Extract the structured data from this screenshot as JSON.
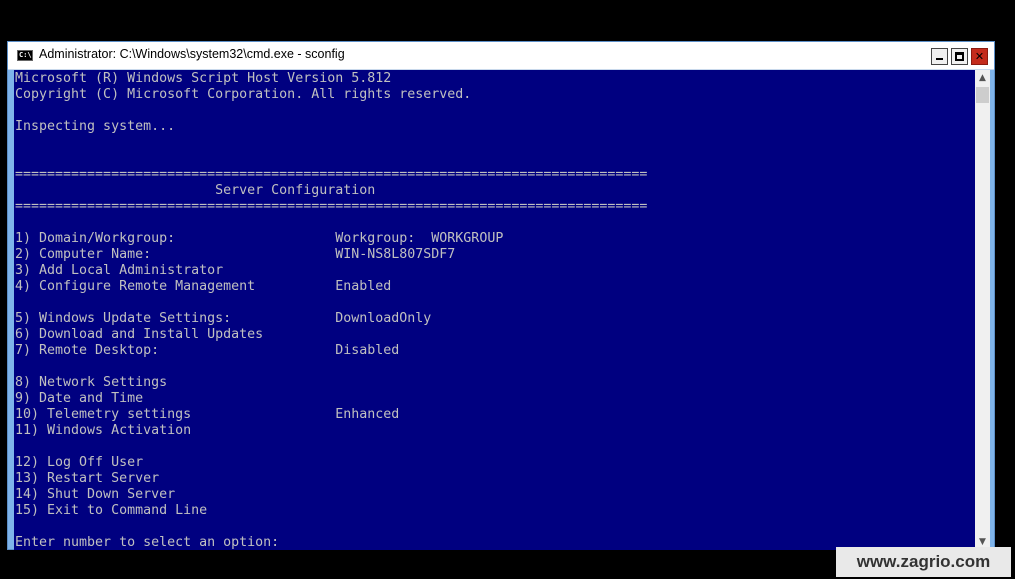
{
  "window": {
    "title": "Administrator: C:\\Windows\\system32\\cmd.exe - sconfig",
    "icon_label": "C:\\"
  },
  "console": {
    "lines": [
      "Microsoft (R) Windows Script Host Version 5.812",
      "Copyright (C) Microsoft Corporation. All rights reserved.",
      "",
      "Inspecting system...",
      "",
      "",
      "===============================================================================",
      "                         Server Configuration",
      "===============================================================================",
      "",
      "1) Domain/Workgroup:                    Workgroup:  WORKGROUP",
      "2) Computer Name:                       WIN-NS8L807SDF7",
      "3) Add Local Administrator",
      "4) Configure Remote Management          Enabled",
      "",
      "5) Windows Update Settings:             DownloadOnly",
      "6) Download and Install Updates",
      "7) Remote Desktop:                      Disabled",
      "",
      "8) Network Settings",
      "9) Date and Time",
      "10) Telemetry settings                  Enhanced",
      "11) Windows Activation",
      "",
      "12) Log Off User",
      "13) Restart Server",
      "14) Shut Down Server",
      "15) Exit to Command Line",
      "",
      "Enter number to select an option:"
    ]
  },
  "scrollbar": {
    "up_arrow": "▲",
    "down_arrow": "▼"
  },
  "watermark": "www.zagrio.com",
  "colors": {
    "console_background": "#000080",
    "console_text": "#c0c0c0",
    "window_frame": "#7fb4ea",
    "close_button": "#c42b1c"
  }
}
